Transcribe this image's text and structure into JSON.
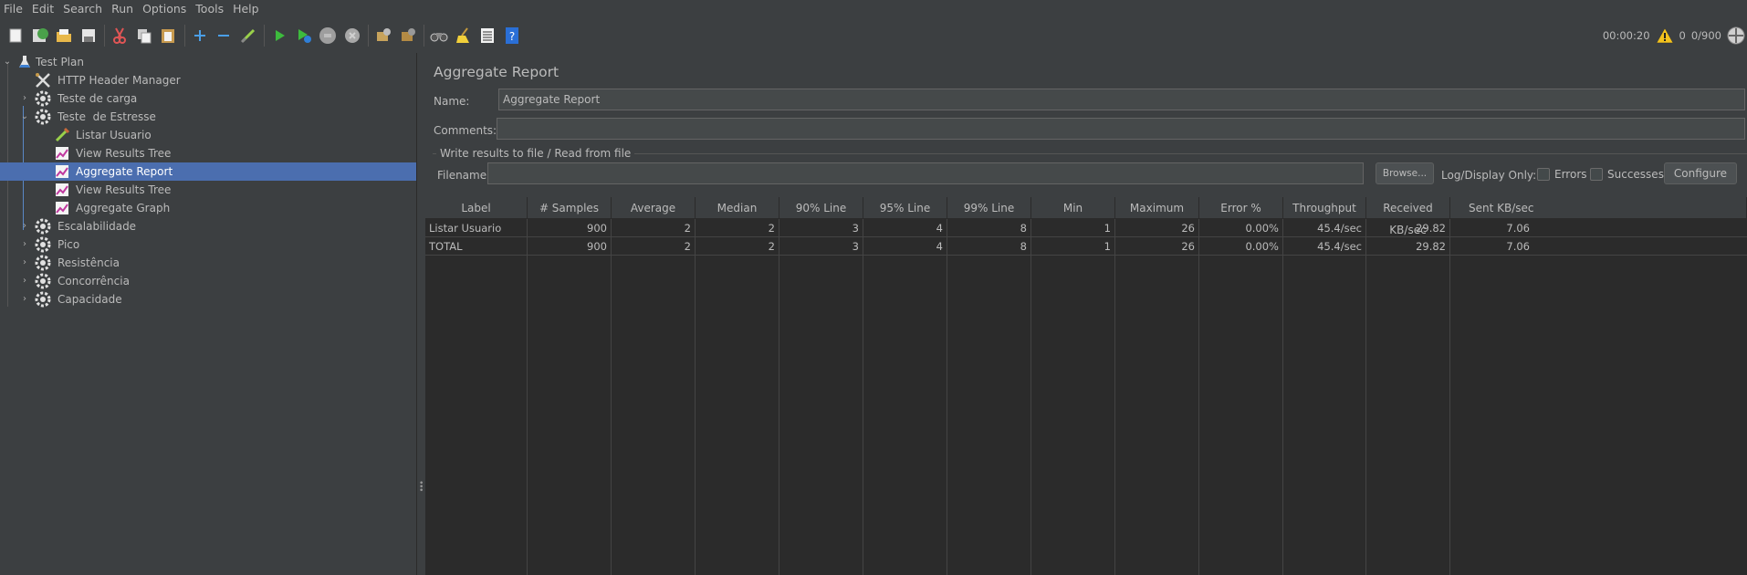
{
  "menu": [
    "File",
    "Edit",
    "Search",
    "Run",
    "Options",
    "Tools",
    "Help"
  ],
  "status": {
    "timer": "00:00:20",
    "warnings": "0",
    "threads": "0/900"
  },
  "tree": [
    {
      "label": "Test Plan",
      "icon": "flask-icon"
    },
    {
      "label": "HTTP Header Manager",
      "icon": "tools-icon"
    },
    {
      "label": "Teste de carga",
      "icon": "gear-icon"
    },
    {
      "label": "Teste  de Estresse",
      "icon": "gear-icon"
    },
    {
      "label": "Listar Usuario",
      "icon": "pipette-icon"
    },
    {
      "label": "View Results Tree",
      "icon": "graph-icon"
    },
    {
      "label": "Aggregate Report",
      "icon": "graph-icon"
    },
    {
      "label": "View Results Tree",
      "icon": "graph-icon"
    },
    {
      "label": "Aggregate Graph",
      "icon": "graph-icon"
    },
    {
      "label": "Escalabilidade",
      "icon": "gear-icon"
    },
    {
      "label": "Pico",
      "icon": "gear-icon"
    },
    {
      "label": "Resistência",
      "icon": "gear-icon"
    },
    {
      "label": "Concorrência",
      "icon": "gear-icon"
    },
    {
      "label": "Capacidade",
      "icon": "gear-icon"
    }
  ],
  "panel": {
    "title": "Aggregate Report",
    "name_label": "Name:",
    "name_value": "Aggregate Report",
    "comments_label": "Comments:",
    "comments_value": "",
    "group_title": "Write results to file / Read from file",
    "filename_label": "Filename",
    "filename_value": "",
    "browse_label": "Browse...",
    "logdisplay_label": "Log/Display Only:",
    "errors_label": "Errors",
    "successes_label": "Successes",
    "configure_label": "Configure"
  },
  "table": {
    "headers": [
      "Label",
      "# Samples",
      "Average",
      "Median",
      "90% Line",
      "95% Line",
      "99% Line",
      "Min",
      "Maximum",
      "Error %",
      "Throughput",
      "Received KB/sec",
      "Sent KB/sec"
    ],
    "rows": [
      [
        "Listar Usuario",
        "900",
        "2",
        "2",
        "3",
        "4",
        "8",
        "1",
        "26",
        "0.00%",
        "45.4/sec",
        "29.82",
        "7.06"
      ],
      [
        "TOTAL",
        "900",
        "2",
        "2",
        "3",
        "4",
        "8",
        "1",
        "26",
        "0.00%",
        "45.4/sec",
        "29.82",
        "7.06"
      ]
    ]
  },
  "colors": {
    "background": "#3c3f41",
    "selection": "#4b6eaf",
    "table_bg": "#2b2b2b"
  }
}
